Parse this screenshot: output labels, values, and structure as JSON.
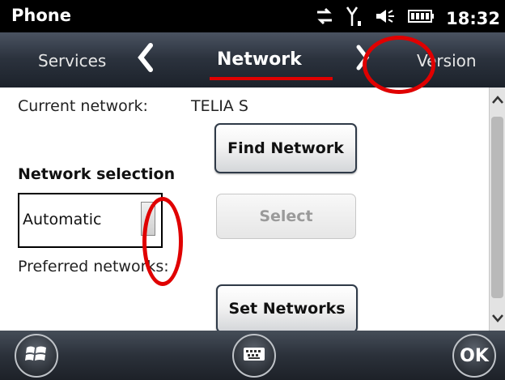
{
  "status_bar": {
    "title": "Phone",
    "time": "18:32"
  },
  "tabs": {
    "left_label": "Services",
    "active_label": "Network",
    "right_label": "Version"
  },
  "network": {
    "current_label": "Current network:",
    "current_value": "TELIA S",
    "find_button": "Find Network",
    "selection_heading": "Network selection",
    "selection_value": "Automatic",
    "select_button": "Select",
    "preferred_label": "Preferred networks:",
    "set_button": "Set Networks"
  },
  "bottom_bar": {
    "ok_label": "OK"
  },
  "icons": {
    "data_connection": "data-connection-icon",
    "signal": "signal-icon",
    "volume": "volume-icon",
    "battery": "battery-icon",
    "start": "windows-logo-icon",
    "keyboard": "keyboard-icon"
  },
  "colors": {
    "annotation": "#e00000",
    "status_bar": "#000000",
    "tab_bar": "#2b323d"
  }
}
